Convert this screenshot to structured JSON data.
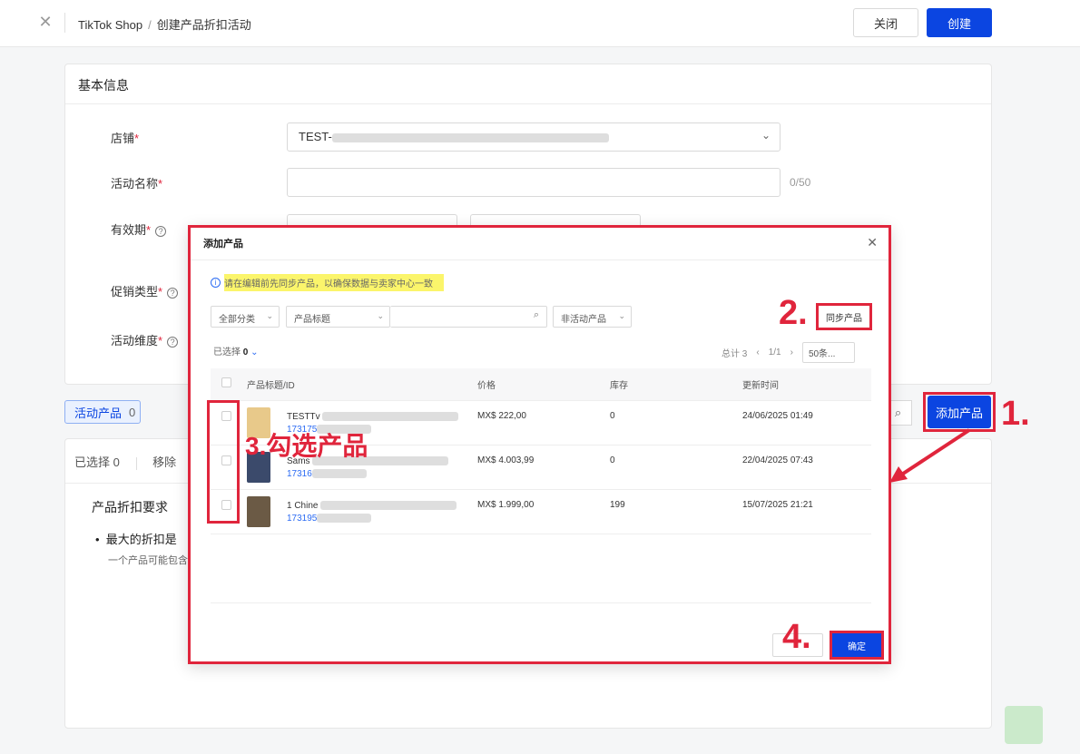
{
  "topbar": {
    "breadcrumb_root": "TikTok Shop",
    "breadcrumb_sep": "/",
    "breadcrumb_current": "创建产品折扣活动",
    "close_label": "关闭",
    "create_label": "创建"
  },
  "basic_info": {
    "title": "基本信息",
    "store_label": "店铺",
    "store_value": "TEST-",
    "name_label": "活动名称",
    "name_counter": "0/50",
    "validity_label": "有效期",
    "promo_type_label": "促销类型",
    "dimension_label": "活动维度",
    "required_mark": "*"
  },
  "products_section": {
    "tab_label": "活动产品",
    "tab_count": "0",
    "add_button": "添加产品",
    "selected_label": "已选择",
    "selected_count": "0",
    "remove_label": "移除",
    "requirements_title": "产品折扣要求",
    "requirement_bullet": "最大的折扣是",
    "requirement_desc": "一个产品可能包含"
  },
  "modal": {
    "title": "添加产品",
    "notice": "请在编辑前先同步产品，以确保数据与卖家中心一致",
    "filter_category": "全部分类",
    "filter_field": "产品标题",
    "filter_status": "非活动产品",
    "sync_button": "同步产品",
    "selected_prefix": "已选择",
    "selected_count": "0",
    "total_label": "总计 3",
    "page_indicator": "1/1",
    "page_size": "50条...",
    "columns": [
      "产品标题/ID",
      "价格",
      "库存",
      "更新时间"
    ],
    "rows": [
      {
        "title": "TESTTv",
        "id": "173175",
        "price": "MX$ 222,00",
        "stock": "0",
        "updated": "24/06/2025 01:49",
        "thumb_color": "#e8c98a"
      },
      {
        "title": "Sams",
        "id": "17316",
        "price": "MX$ 4.003,99",
        "stock": "0",
        "updated": "22/04/2025 07:43",
        "thumb_color": "#3b4a6b"
      },
      {
        "title": "1 Chine",
        "id": "173195",
        "price": "MX$ 1.999,00",
        "stock": "199",
        "updated": "15/07/2025 21:21",
        "thumb_color": "#6b5a45"
      }
    ],
    "confirm_button": "确定"
  },
  "annotations": {
    "step1": "1.",
    "step2": "2.",
    "step3": "3.勾选产品",
    "step4": "4.",
    "accent_color": "#e0253c"
  },
  "icons": {
    "close": "close-icon",
    "chevron": "chevron-down-icon",
    "help": "help-circle-icon",
    "search": "search-icon",
    "info": "info-icon"
  }
}
